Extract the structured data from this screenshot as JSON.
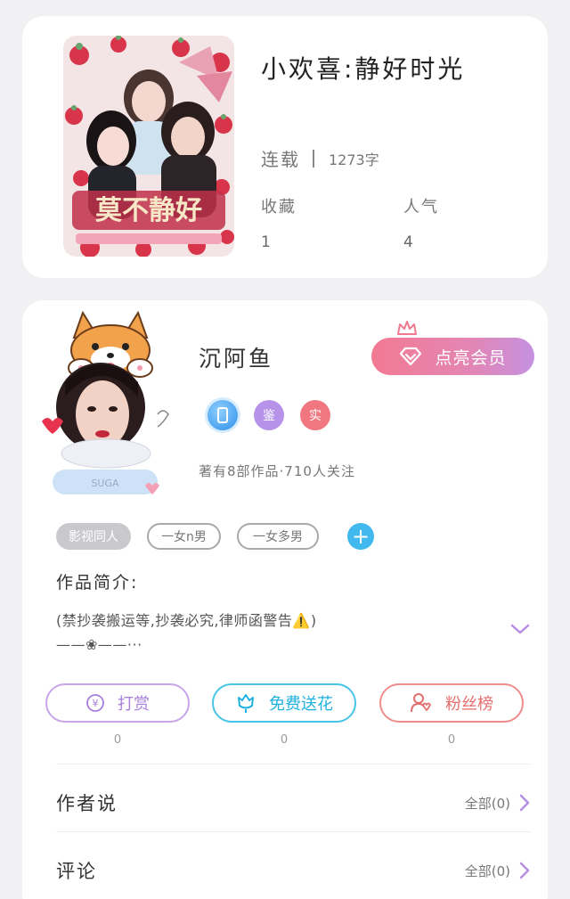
{
  "book": {
    "cover_title_text": "莫不静好",
    "title": "小欢喜:静好时光",
    "status": "连载",
    "word_count": "1273字",
    "stats": {
      "favorites_label": "收藏",
      "favorites_value": "1",
      "popularity_label": "人气",
      "popularity_value": "4"
    }
  },
  "author": {
    "name": "沉阿鱼",
    "vip_button_label": "点亮会员",
    "badges": [
      "blue-phone-badge",
      "鉴",
      "实"
    ],
    "meta": "著有8部作品·710人关注",
    "avatar_caption": "SUGA",
    "tags": [
      "影视同人",
      "一女n男",
      "一女多男"
    ],
    "intro_title": "作品简介:",
    "intro_text_line1": "(禁抄袭搬运等,抄袭必究,律师函警告⚠️)",
    "intro_text_line2": "——❀——···"
  },
  "actions": {
    "reward_label": "打赏",
    "reward_count": "0",
    "flower_label": "免费送花",
    "flower_count": "0",
    "fans_label": "粉丝榜",
    "fans_count": "0"
  },
  "sections": {
    "author_says_title": "作者说",
    "author_says_right": "全部(0)",
    "comments_title": "评论",
    "comments_right": "全部(0)"
  },
  "colors": {
    "vip_gradient_start": "#f27a92",
    "vip_gradient_end": "#c591e0",
    "reward": "#a77fdc",
    "flower": "#1fb2e0",
    "fans": "#e46e6e",
    "add_button": "#41b9ee"
  }
}
